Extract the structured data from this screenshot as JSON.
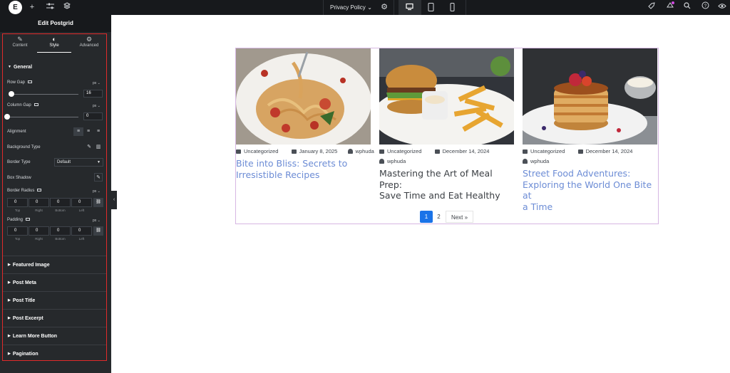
{
  "topbar": {
    "page_name": "Privacy Policy"
  },
  "panel": {
    "title": "Edit Postgrid",
    "tabs": [
      "Content",
      "Style",
      "Advanced"
    ],
    "general": {
      "title": "General",
      "row_gap": {
        "label": "Row Gap",
        "unit": "px",
        "value": "16",
        "level": 0.0
      },
      "column_gap": {
        "label": "Column Gap",
        "unit": "px",
        "value": "0",
        "level": 0.0
      },
      "alignment": {
        "label": "Alignment"
      },
      "background_type": {
        "label": "Background Type"
      },
      "border_type": {
        "label": "Border Type",
        "value": "Default"
      },
      "box_shadow": {
        "label": "Box Shadow"
      },
      "border_radius": {
        "label": "Border Radius",
        "unit": "px",
        "values": [
          "0",
          "0",
          "0",
          "0"
        ]
      },
      "padding": {
        "label": "Padding",
        "unit": "px",
        "values": [
          "0",
          "0",
          "0",
          "0"
        ]
      },
      "dim_labels": [
        "Top",
        "Right",
        "Bottom",
        "Left"
      ]
    },
    "sections": [
      "Featured Image",
      "Post Meta",
      "Post Title",
      "Post Excerpt",
      "Learn More Button",
      "Pagination"
    ]
  },
  "posts": [
    {
      "category": "Uncategorized",
      "date": "January 8, 2025",
      "author": "wphuda",
      "title_line1": "Bite into Bliss: Secrets to",
      "title_line2": "Irresistible Recipes",
      "title_line3": ""
    },
    {
      "category": "Uncategorized",
      "date": "December 14, 2024",
      "author": "wphuda",
      "title_line1": "Mastering the Art of Meal Prep:",
      "title_line2": "Save Time and Eat Healthy",
      "title_line3": ""
    },
    {
      "category": "Uncategorized",
      "date": "December 14, 2024",
      "author": "wphuda",
      "title_line1": "Street Food Adventures:",
      "title_line2": "Exploring the World One Bite at",
      "title_line3": "a Time"
    }
  ],
  "pagination": {
    "page1": "1",
    "page2": "2",
    "next": "Next »"
  },
  "colors": {
    "accent": "#1a73e8",
    "link": "#6c8cd5",
    "panel_bg": "#26292c",
    "highlight": "#e02a2a"
  }
}
